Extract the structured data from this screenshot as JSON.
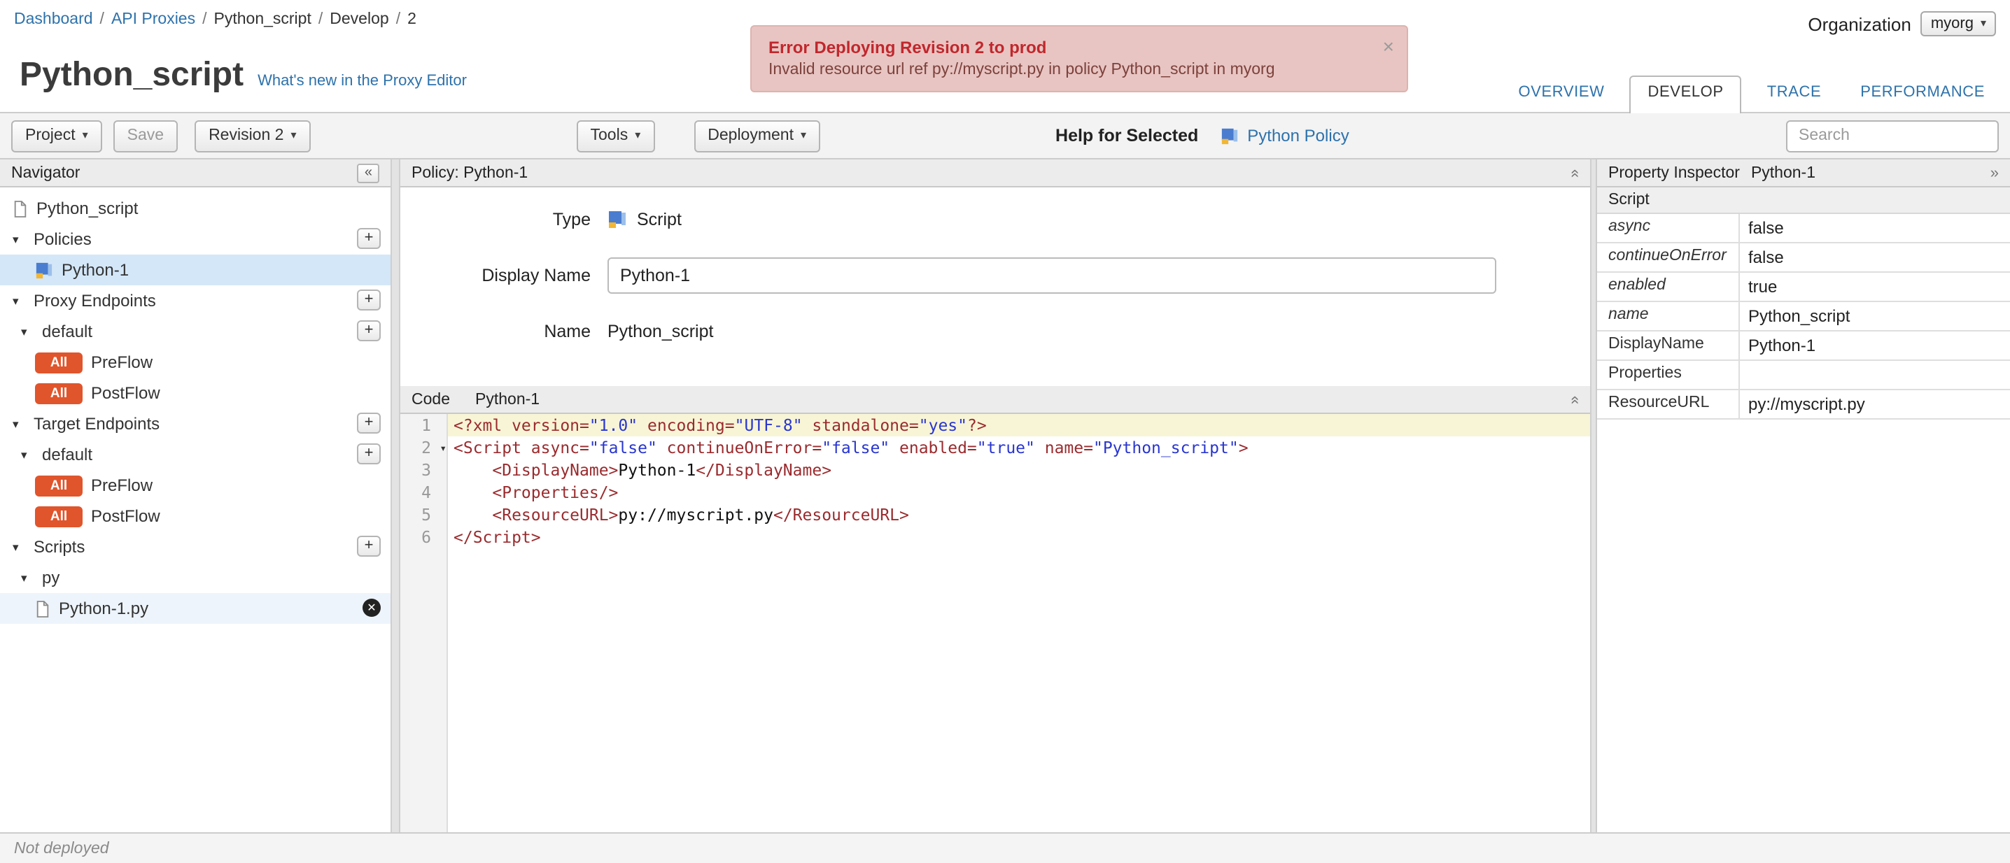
{
  "colors": {
    "accent_blue": "#2d72ab",
    "error_bg": "#e8c5c2",
    "error_title_red": "#c1272d",
    "badge_orange": "#e0552c",
    "selected_row_blue": "#d4e7f8",
    "code_tag": "#9a2b2e",
    "code_string": "#2936cf"
  },
  "icons": {
    "caret_down": "▾",
    "tri_down": "▾",
    "collapse_left": "«",
    "expand_right": "»",
    "plus": "+",
    "close": "×",
    "remove": "✕"
  },
  "breadcrumb": {
    "separator": "/",
    "items": [
      "Dashboard",
      "API Proxies",
      "Python_script",
      "Develop",
      "2"
    ]
  },
  "org": {
    "label": "Organization",
    "value": "myorg"
  },
  "banner": {
    "title": "Error Deploying Revision 2 to prod",
    "message": "Invalid resource url ref py://myscript.py in policy Python_script in myorg"
  },
  "page": {
    "title": "Python_script",
    "whats_new_link": "What's new in the Proxy Editor"
  },
  "tabs": {
    "overview": "OVERVIEW",
    "develop": "DEVELOP",
    "trace": "TRACE",
    "performance": "PERFORMANCE"
  },
  "toolbar": {
    "project": "Project",
    "save": "Save",
    "revision": "Revision 2",
    "tools": "Tools",
    "deployment": "Deployment",
    "help_for_selected": "Help for Selected",
    "policy_link": "Python Policy",
    "search_placeholder": "Search"
  },
  "navigator": {
    "title": "Navigator",
    "items": [
      {
        "label": "Python_script"
      },
      {
        "label": "Policies"
      },
      {
        "label": "Python-1"
      },
      {
        "label": "Proxy Endpoints"
      },
      {
        "label": "default"
      },
      {
        "label": "PreFlow",
        "badge": "All"
      },
      {
        "label": "PostFlow",
        "badge": "All"
      },
      {
        "label": "Target Endpoints"
      },
      {
        "label": "default"
      },
      {
        "label": "PreFlow",
        "badge": "All"
      },
      {
        "label": "PostFlow",
        "badge": "All"
      },
      {
        "label": "Scripts"
      },
      {
        "label": "py"
      },
      {
        "label": "Python-1.py"
      }
    ]
  },
  "policy": {
    "header": "Policy: Python-1",
    "type_label": "Type",
    "type_value": "Script",
    "display_name_label": "Display Name",
    "display_name_value": "Python-1",
    "name_label": "Name",
    "name_value": "Python_script"
  },
  "code": {
    "title": "Code",
    "subtitle": "Python-1",
    "lines": [
      {
        "num": "1",
        "segments": [
          {
            "t": "<?xml version="
          },
          {
            "t": "\"1.0\""
          },
          {
            "t": " encoding="
          },
          {
            "t": "\"UTF-8\""
          },
          {
            "t": " standalone="
          },
          {
            "t": "\"yes\""
          },
          {
            "t": "?>"
          }
        ]
      },
      {
        "num": "2",
        "segments": [
          {
            "t": "<Script async="
          },
          {
            "t": "\"false\""
          },
          {
            "t": " continueOnError="
          },
          {
            "t": "\"false\""
          },
          {
            "t": " enabled="
          },
          {
            "t": "\"true\""
          },
          {
            "t": " name="
          },
          {
            "t": "\"Python_script\""
          },
          {
            "t": ">"
          }
        ]
      },
      {
        "num": "3",
        "segments": [
          {
            "t": "    <DisplayName>"
          },
          {
            "t": "Python-1"
          },
          {
            "t": "</DisplayName>"
          }
        ]
      },
      {
        "num": "4",
        "segments": [
          {
            "t": "    <Properties/>"
          }
        ]
      },
      {
        "num": "5",
        "segments": [
          {
            "t": "    <ResourceURL>"
          },
          {
            "t": "py://myscript.py"
          },
          {
            "t": "</ResourceURL>"
          }
        ]
      },
      {
        "num": "6",
        "segments": [
          {
            "t": "</Script>"
          }
        ]
      }
    ]
  },
  "inspector": {
    "title": "Property Inspector",
    "subtitle": "Python-1",
    "section": "Script",
    "rows": [
      {
        "name": "async",
        "value": "false"
      },
      {
        "name": "continueOnError",
        "value": "false"
      },
      {
        "name": "enabled",
        "value": "true"
      },
      {
        "name": "name",
        "value": "Python_script"
      },
      {
        "name": "DisplayName",
        "value": "Python-1"
      },
      {
        "name": "Properties",
        "value": ""
      },
      {
        "name": "ResourceURL",
        "value": "py://myscript.py"
      }
    ]
  },
  "statusbar": {
    "text": "Not deployed"
  }
}
